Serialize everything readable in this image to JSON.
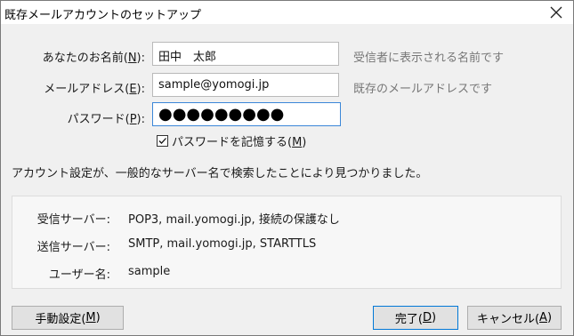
{
  "window": {
    "title": "既存メールアカウントのセットアップ"
  },
  "form": {
    "name": {
      "label_pre": "あなたのお名前(",
      "label_key": "N",
      "label_post": "):",
      "value": "田中　太郎",
      "hint": "受信者に表示される名前です"
    },
    "email": {
      "label_pre": "メールアドレス(",
      "label_key": "E",
      "label_post": "):",
      "value": "sample@yomogi.jp",
      "hint": "既存のメールアドレスです"
    },
    "password": {
      "label_pre": "パスワード(",
      "label_key": "P",
      "label_post": "):",
      "masked_value": "●●●●●●●●●"
    },
    "remember": {
      "label_pre": "パスワードを記憶する(",
      "label_key": "M",
      "label_post": ")",
      "checked": true
    }
  },
  "status_message": "アカウント設定が、一般的なサーバー名で検索したことにより見つかりました。",
  "server_info": {
    "incoming_label": "受信サーバー:",
    "incoming_value": "POP3, mail.yomogi.jp, 接続の保護なし",
    "outgoing_label": "送信サーバー:",
    "outgoing_value": "SMTP, mail.yomogi.jp, STARTTLS",
    "username_label": "ユーザー名:",
    "username_value": "sample"
  },
  "buttons": {
    "manual_pre": "手動設定(",
    "manual_key": "M",
    "manual_post": ")",
    "done_pre": "完了(",
    "done_key": "D",
    "done_post": ")",
    "cancel_pre": "キャンセル(",
    "cancel_key": "A",
    "cancel_post": ")"
  }
}
